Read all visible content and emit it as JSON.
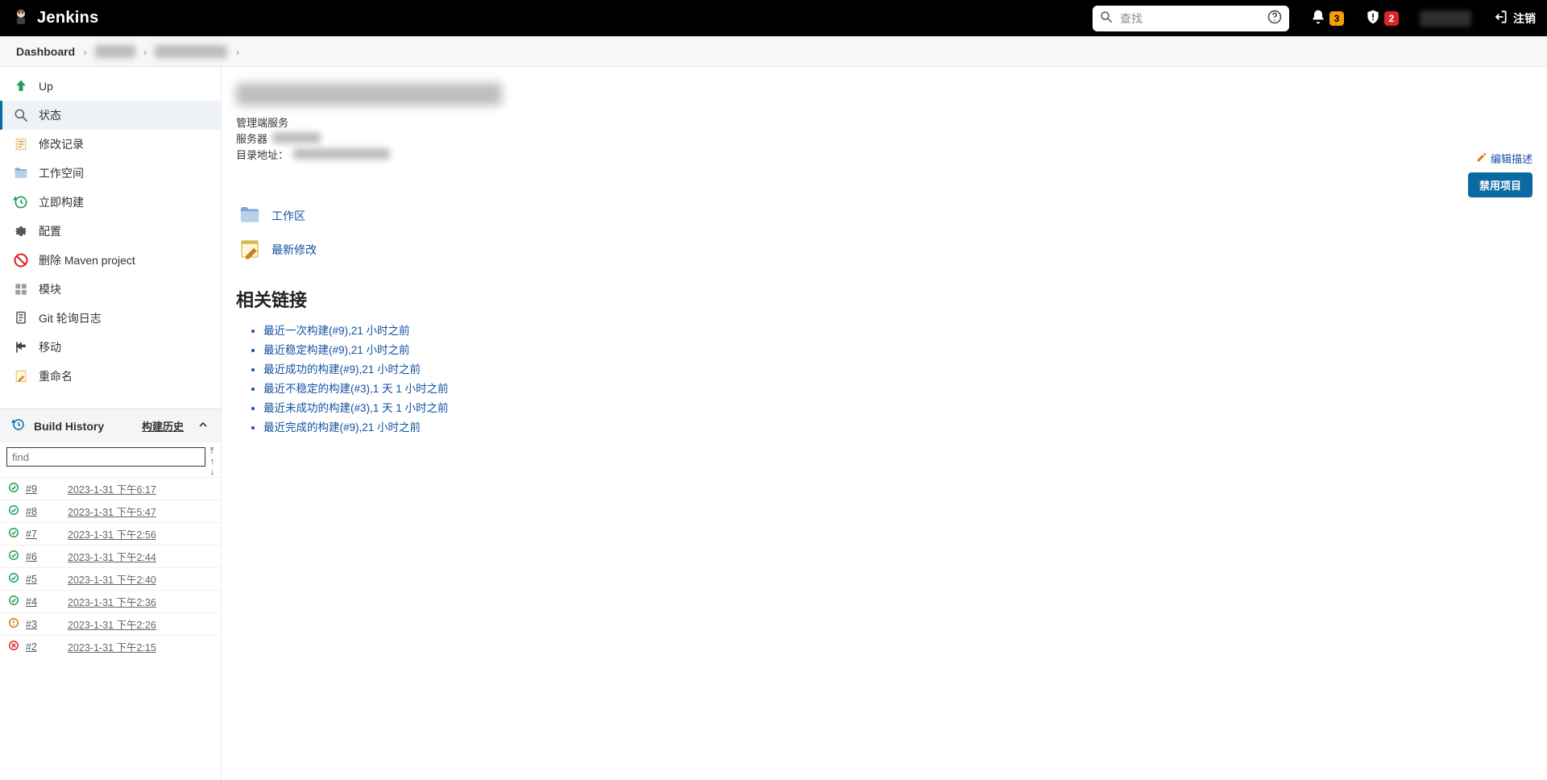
{
  "header": {
    "brand": "Jenkins",
    "search_placeholder": "查找",
    "notification_count": "3",
    "security_count": "2",
    "logout": "注销"
  },
  "breadcrumb": {
    "dashboard": "Dashboard"
  },
  "sidebar": {
    "items": [
      {
        "icon": "up-icon",
        "label": "Up"
      },
      {
        "icon": "search-icon",
        "label": "状态"
      },
      {
        "icon": "changelog-icon",
        "label": "修改记录"
      },
      {
        "icon": "folder-icon",
        "label": "工作空间"
      },
      {
        "icon": "build-icon",
        "label": "立即构建"
      },
      {
        "icon": "gear-icon",
        "label": "配置"
      },
      {
        "icon": "delete-icon",
        "label": "删除 Maven project"
      },
      {
        "icon": "module-icon",
        "label": "模块"
      },
      {
        "icon": "poll-icon",
        "label": "Git 轮询日志"
      },
      {
        "icon": "move-icon",
        "label": "移动"
      },
      {
        "icon": "rename-icon",
        "label": "重命名"
      }
    ]
  },
  "build_history": {
    "title": "Build History",
    "trend_label": "构建历史",
    "find_placeholder": "find",
    "rows": [
      {
        "status": "ok",
        "id": "#9",
        "ts": "2023-1-31 下午6:17"
      },
      {
        "status": "ok",
        "id": "#8",
        "ts": "2023-1-31 下午5:47"
      },
      {
        "status": "ok",
        "id": "#7",
        "ts": "2023-1-31 下午2:56"
      },
      {
        "status": "ok",
        "id": "#6",
        "ts": "2023-1-31 下午2:44"
      },
      {
        "status": "ok",
        "id": "#5",
        "ts": "2023-1-31 下午2:40"
      },
      {
        "status": "ok",
        "id": "#4",
        "ts": "2023-1-31 下午2:36"
      },
      {
        "status": "warn",
        "id": "#3",
        "ts": "2023-1-31 下午2:26"
      },
      {
        "status": "fail",
        "id": "#2",
        "ts": "2023-1-31 下午2:15"
      }
    ]
  },
  "main": {
    "desc_line1": "管理端服务",
    "desc_line2_label": "服务器",
    "desc_line3_label": "目录地址：",
    "edit_desc": "编辑描述",
    "disable_btn": "禁用项目",
    "workspace_link": "工作区",
    "changes_link": "最新修改",
    "section_title": "相关链接",
    "perm_links": [
      "最近一次构建(#9),21 小时之前",
      "最近稳定构建(#9),21 小时之前",
      "最近成功的构建(#9),21 小时之前",
      "最近不稳定的构建(#3),1 天 1 小时之前",
      "最近未成功的构建(#3),1 天 1 小时之前",
      "最近完成的构建(#9),21 小时之前"
    ]
  },
  "colors": {
    "accent": "#0b6aa2",
    "link": "#1252a0",
    "ok": "#1f9d55",
    "warn": "#d97706",
    "fail": "#dc2626"
  }
}
